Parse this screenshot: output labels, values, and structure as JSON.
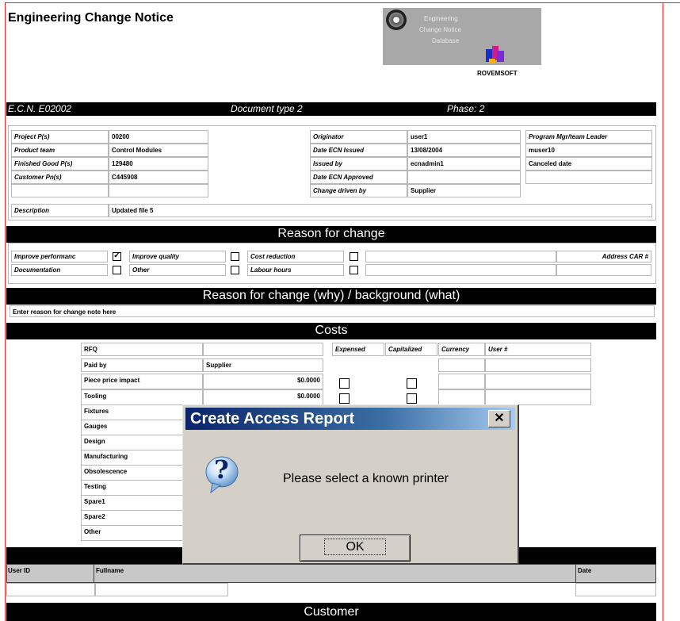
{
  "doc": {
    "title": "Engineering Change Notice",
    "logo_lines": [
      "Engineering",
      "Change Notice",
      "Database"
    ],
    "logo_caption": "ROVEMSOFT",
    "header_bar": {
      "ecn": "E.C.N. E02002",
      "doc_type": "Document type 2",
      "phase": "Phase: 2"
    }
  },
  "info": {
    "project_label": "Project P(s)",
    "project_value": "00200",
    "product_label": "Product team",
    "product_value": "Control Modules",
    "finished_label": "Finished Good P(s)",
    "finished_value": "129480",
    "customer_label": "Customer Pn(s)",
    "customer_value": "C445908",
    "description_label": "Description",
    "description_value": "Updated file 5",
    "originator_label": "Originator",
    "originator_value": "user1",
    "date_issued_label": "Date ECN Issued",
    "date_issued_value": "13/08/2004",
    "issued_by_label": "Issued by",
    "issued_by_value": "ecnadmin1",
    "date_approved_label": "Date ECN Approved",
    "date_approved_value": "",
    "change_driven_label": "Change driven by",
    "change_driven_value": "Supplier",
    "program_mgr_label": "Program Mgr/team Leader",
    "program_mgr_value": "muser10",
    "canceled_label": "Canceled date"
  },
  "reason": {
    "heading": "Reason for change",
    "improve_perf": "Improve performanc",
    "improve_perf_checked": true,
    "improve_quality": "Improve quality",
    "cost_reduction": "Cost reduction",
    "address_car": "Address CAR #",
    "documentation": "Documentation",
    "other": "Other",
    "labour_hours": "Labour hours"
  },
  "why": {
    "heading": "Reason for change (why) / background (what)",
    "text": "Enter reason for change note here"
  },
  "costs": {
    "heading": "Costs",
    "col_expensed": "Expensed",
    "col_capitalized": "Capitalized",
    "col_currency": "Currency",
    "col_user": "User #",
    "rows": [
      {
        "label": "RFQ",
        "value": ""
      },
      {
        "label": "Paid by",
        "value": "Supplier"
      },
      {
        "label": "Piece price impact",
        "value": "$0.0000"
      },
      {
        "label": "Tooling",
        "value": "$0.0000"
      },
      {
        "label": "Fixtures",
        "value": ""
      },
      {
        "label": "Gauges",
        "value": ""
      },
      {
        "label": "Design",
        "value": ""
      },
      {
        "label": "Manufacturing",
        "value": ""
      },
      {
        "label": "Obsolescence",
        "value": ""
      },
      {
        "label": "Testing",
        "value": ""
      },
      {
        "label": "Spare1",
        "value": ""
      },
      {
        "label": "Spare2",
        "value": ""
      },
      {
        "label": "Other",
        "value": ""
      }
    ]
  },
  "approvals": {
    "col_user": "User ID",
    "col_fullname": "Fullname",
    "col_date": "Date"
  },
  "customer": {
    "heading": "Customer"
  },
  "dialog": {
    "title": "Create Access Report",
    "close": "✕",
    "message": "Please select a known printer",
    "ok": "OK",
    "question_glyph": "?"
  },
  "colors": {
    "frame": "#d9262b",
    "titlebar": "#0a246a",
    "dialog_bg": "#d4d0c8"
  }
}
